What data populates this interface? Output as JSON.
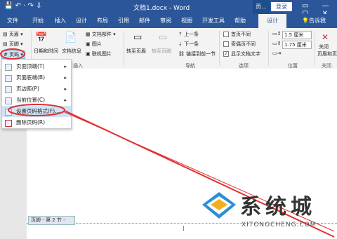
{
  "titlebar": {
    "qat": "💾 ↶ · ↷ ⇩",
    "document_title": "文档1.docx - Word",
    "context_title": "页...",
    "login_button": "登录",
    "window_controls": "▭ — ▢ ✕"
  },
  "tabs": {
    "file": "文件",
    "home": "开始",
    "insert": "插入",
    "design": "设计",
    "layout": "布局",
    "references": "引用",
    "mailings": "邮件",
    "review": "审阅",
    "view": "视图",
    "developer": "开发工具",
    "help": "帮助",
    "hf_design": "设计",
    "tell_me": "告诉我"
  },
  "ribbon": {
    "header": "页眉",
    "footer": "页脚",
    "page_number": "页码",
    "date_time": "日期和时间",
    "doc_info": "文档信息",
    "doc_parts": "文档部件",
    "picture": "图片",
    "online_picture": "联机图片",
    "insert_group": "插入",
    "goto_header": "转至页眉",
    "goto_footer": "转至页脚",
    "prev": "上一条",
    "next": "下一条",
    "link_prev": "链接到前一节",
    "nav_group": "导航",
    "first_page_diff": "首页不同",
    "odd_even_diff": "奇偶页不同",
    "show_doc_text": "显示文档文字",
    "options_group": "选项",
    "header_top_value": "1.5 厘米",
    "footer_bottom_value": "1.75 厘米",
    "third_spin_value": "",
    "position_group": "位置",
    "close_label_1": "关闭",
    "close_label_2": "页眉和页",
    "close_group": "关闭"
  },
  "menu": {
    "items": [
      "页面顶端(T)",
      "页面底端(B)",
      "页边距(P)",
      "当前位置(C)",
      "设置页码格式(F)...",
      "删除页码(R)"
    ]
  },
  "document": {
    "footer_tag": "页脚 - 第 2 节 -",
    "cursor": "⁞"
  },
  "watermark": {
    "text": "系统城",
    "url": "XITONGCHENG.COM"
  },
  "colors": {
    "word_blue": "#2b579a",
    "annotation_red": "#e03030"
  }
}
